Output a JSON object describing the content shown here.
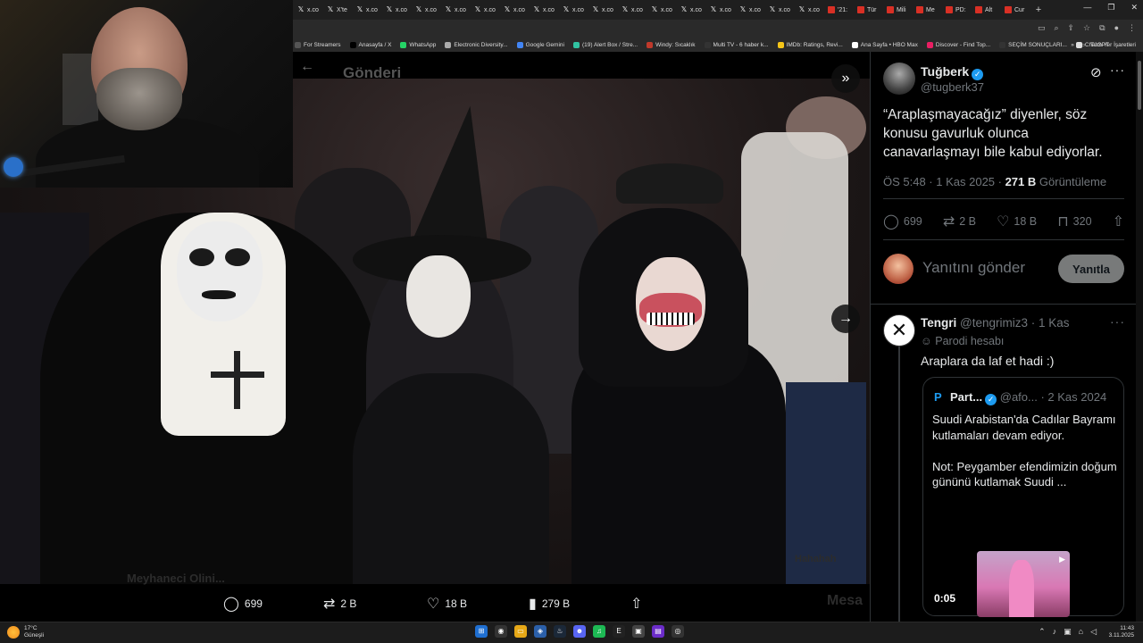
{
  "browser": {
    "tabs": [
      {
        "label": "x.co",
        "icon": "x-icon"
      },
      {
        "label": "X'te",
        "icon": "x-icon"
      },
      {
        "label": "x.co",
        "icon": "x-icon"
      },
      {
        "label": "x.co",
        "icon": "x-icon"
      },
      {
        "label": "x.co",
        "icon": "x-icon"
      },
      {
        "label": "x.co",
        "icon": "x-icon"
      },
      {
        "label": "x.co",
        "icon": "x-icon"
      },
      {
        "label": "x.co",
        "icon": "x-icon"
      },
      {
        "label": "x.co",
        "icon": "x-icon"
      },
      {
        "label": "x.co",
        "icon": "x-icon"
      },
      {
        "label": "x.co",
        "icon": "x-icon"
      },
      {
        "label": "x.co",
        "icon": "x-icon"
      },
      {
        "label": "x.co",
        "icon": "x-icon"
      },
      {
        "label": "x.co",
        "icon": "x-icon"
      },
      {
        "label": "x.co",
        "icon": "x-icon"
      },
      {
        "label": "x.co",
        "icon": "x-icon"
      },
      {
        "label": "x.co",
        "icon": "x-icon"
      },
      {
        "label": "x.co",
        "icon": "x-icon"
      },
      {
        "label": "'21:",
        "icon": "red-icon"
      },
      {
        "label": "Tür",
        "icon": "red-icon"
      },
      {
        "label": "Mili",
        "icon": "red-icon"
      },
      {
        "label": "Me",
        "icon": "red-icon"
      },
      {
        "label": "PD:",
        "icon": "red-icon"
      },
      {
        "label": "Alt",
        "icon": "red-icon"
      },
      {
        "label": "Cur",
        "icon": "red-icon"
      }
    ],
    "new_tab": "+",
    "bookmarks": [
      {
        "label": "For Streamers",
        "color": "#555"
      },
      {
        "label": "Anasayfa / X",
        "color": "#000"
      },
      {
        "label": "WhatsApp",
        "color": "#25d366"
      },
      {
        "label": "Electronic Diversity...",
        "color": "#aaa"
      },
      {
        "label": "Google Gemini",
        "color": "#4285f4"
      },
      {
        "label": "(19) Alert Box / Stre...",
        "color": "#31c3a2"
      },
      {
        "label": "Windy: Sıcaklık",
        "color": "#c0392b"
      },
      {
        "label": "Multi TV - 6 haber k...",
        "color": "#333"
      },
      {
        "label": "IMDb: Ratings, Revi...",
        "color": "#f5c518"
      },
      {
        "label": "Ana Sayfa • HBO Max",
        "color": "#fff"
      },
      {
        "label": "Discover - Find Top...",
        "color": "#e91e63"
      },
      {
        "label": "SEÇİM SONUÇLARI...",
        "color": "#333"
      },
      {
        "label": "ChatGPT",
        "color": "#ddd"
      }
    ],
    "bookmarks_more": "»",
    "all_bookmarks": "Tüm Yer İşaretleri"
  },
  "viewer": {
    "title": "Gönderi",
    "actions": {
      "replies": "699",
      "reposts": "2 B",
      "likes": "18 B",
      "views": "279 B"
    },
    "ghost_name": "Meyhaneci Olini...",
    "ghost_right": "Mesa",
    "ghost_mid": "Hahahah"
  },
  "tweet": {
    "author_name": "Tuğberk",
    "author_handle": "@tugberk37",
    "text": "“Araplaşmayacağız” diyenler, söz konusu gavurluk olunca canavarlaşmayı bile kabul ediyorlar.",
    "time": "ÖS 5:48 · 1 Kas 2025 · ",
    "views": "271 B",
    "views_label": " Görüntüleme",
    "stats": {
      "replies": "699",
      "reposts": "2 B",
      "likes": "18 B",
      "bookmarks": "320"
    },
    "reply_placeholder": "Yanıtını gönder",
    "reply_button": "Yanıtla"
  },
  "reply": {
    "name": "Tengri",
    "handle": "@tengrimiz3 · 1 Kas",
    "label": "Parodi hesabı",
    "text": "Araplara da laf et hadi :)",
    "quote": {
      "name": "Part...",
      "handle": "@afo... · 2 Kas 2024",
      "text": "Suudi Arabistan'da Cadılar Bayramı kutlamaları devam ediyor.\n\nNot: Peygamber efendimizin doğum gününü kutlamak Suudi ...",
      "video_time": "0:05"
    }
  },
  "taskbar": {
    "temp": "17°C",
    "weather": "Güneşli",
    "time": "11:43",
    "date": "3.11.2025"
  }
}
